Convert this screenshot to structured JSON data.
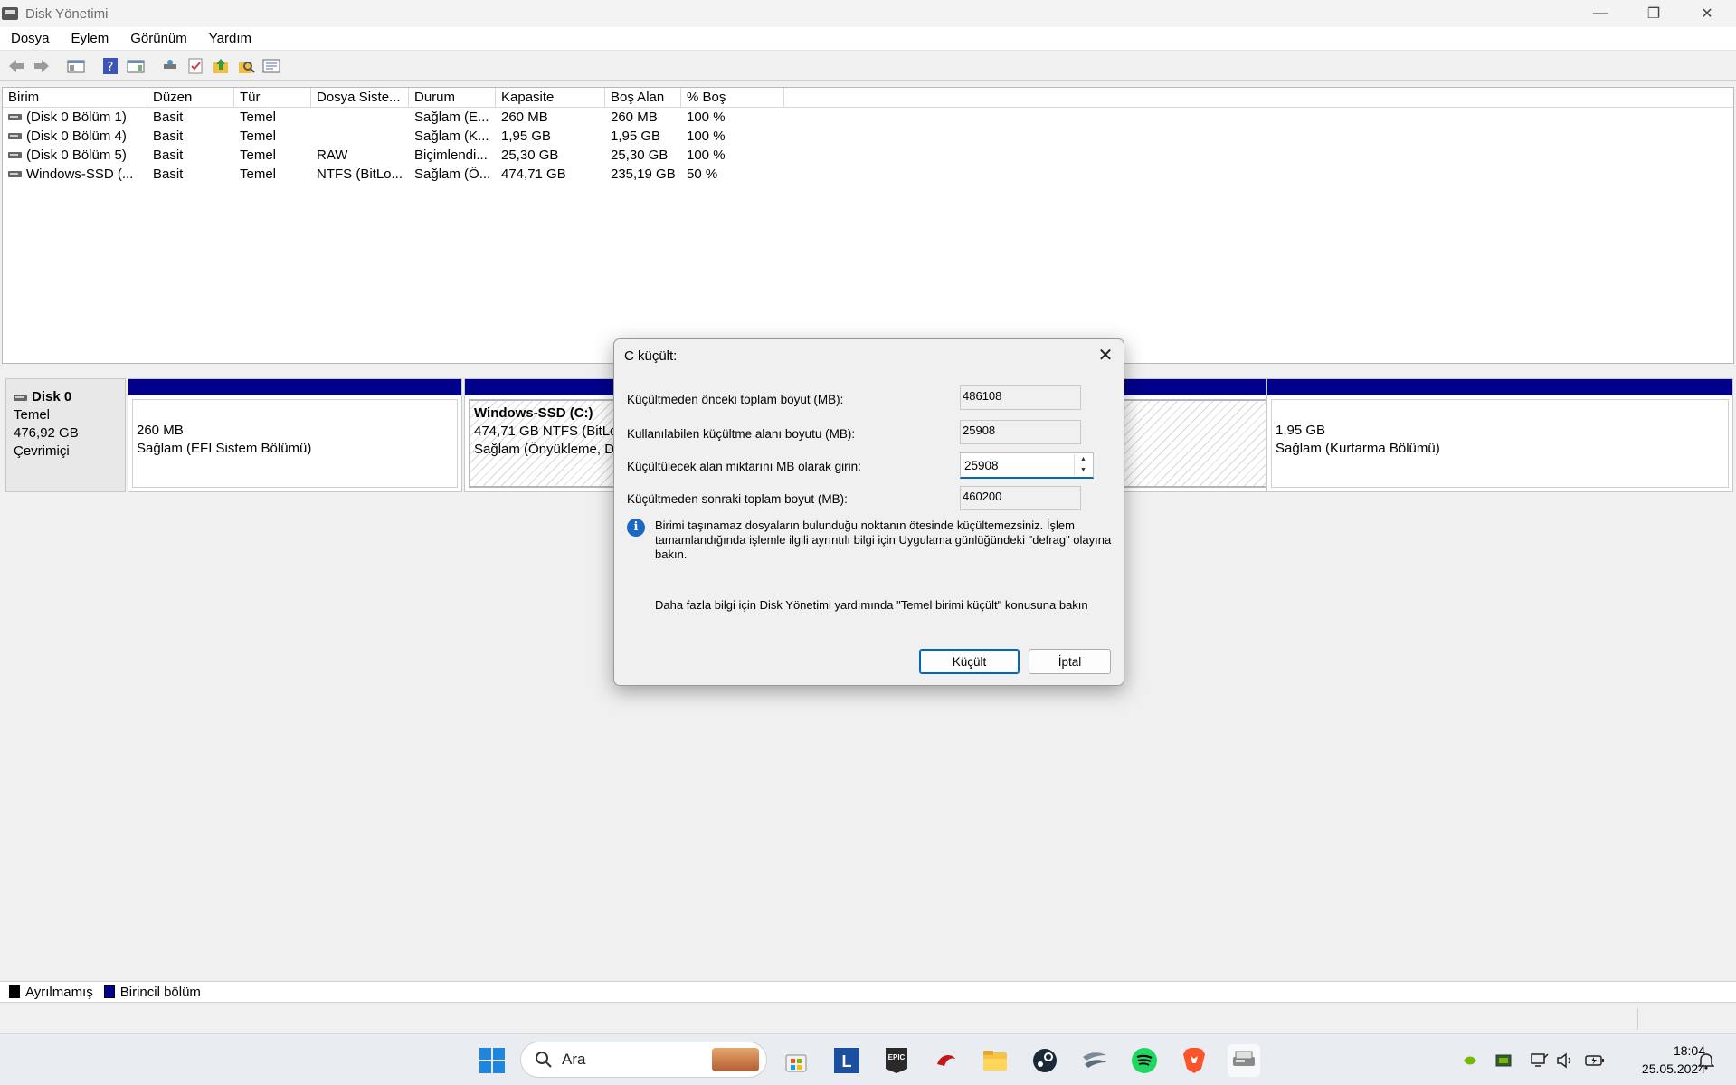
{
  "window": {
    "title": "Disk Yönetimi",
    "min_glyph": "—",
    "max_glyph": "❐",
    "close_glyph": "✕"
  },
  "menu": [
    "Dosya",
    "Eylem",
    "Görünüm",
    "Yardım"
  ],
  "volume_list": {
    "columns": [
      "Birim",
      "Düzen",
      "Tür",
      "Dosya Siste...",
      "Durum",
      "Kapasite",
      "Boş Alan",
      "% Boş"
    ],
    "rows": [
      [
        "(Disk 0 Bölüm 1)",
        "Basit",
        "Temel",
        "",
        "Sağlam (E...",
        "260 MB",
        "260 MB",
        "100 %"
      ],
      [
        "(Disk 0 Bölüm 4)",
        "Basit",
        "Temel",
        "",
        "Sağlam (K...",
        "1,95 GB",
        "1,95 GB",
        "100 %"
      ],
      [
        "(Disk 0 Bölüm 5)",
        "Basit",
        "Temel",
        "RAW",
        "Biçimlendi...",
        "25,30 GB",
        "25,30 GB",
        "100 %"
      ],
      [
        "Windows-SSD (...",
        "Basit",
        "Temel",
        "NTFS (BitLo...",
        "Sağlam (Ö...",
        "474,71 GB",
        "235,19 GB",
        "50 %"
      ]
    ]
  },
  "disk": {
    "name": "Disk 0",
    "type": "Temel",
    "size": "476,92 GB",
    "status": "Çevrimiçi",
    "partitions": [
      {
        "line1": "",
        "line2": "260 MB",
        "line3": "Sağlam (EFI Sistem Bölümü)"
      },
      {
        "line1": "Windows-SSD  (C:)",
        "line2": "474,71 GB NTFS (BitLoc",
        "line3": "Sağlam (Önyükleme, D"
      },
      {
        "line1": "",
        "line2": "1,95 GB",
        "line3": "Sağlam (Kurtarma Bölümü)"
      }
    ]
  },
  "legend": {
    "unallocated": "Ayrılmamış",
    "primary": "Birincil bölüm",
    "unallocated_color": "#000000",
    "primary_color": "#00008b"
  },
  "dialog": {
    "title": "C küçült:",
    "total_before_label": "Küçültmeden önceki toplam boyut (MB):",
    "total_before_value": "486108",
    "available_label": "Kullanılabilen küçültme alanı boyutu (MB):",
    "available_value": "25908",
    "enter_label": "Küçültülecek alan miktarını MB olarak girin:",
    "enter_value": "25908",
    "total_after_label": "Küçültmeden sonraki toplam boyut (MB):",
    "total_after_value": "460200",
    "info_text": "Birimi taşınamaz dosyaların bulunduğu noktanın ötesinde küçültemezsiniz. İşlem tamamlandığında işlemle ilgili ayrıntılı bilgi için Uygulama günlüğündeki \"defrag\" olayına bakın.",
    "help_text": "Daha fazla bilgi için Disk Yönetimi yardımında \"Temel birimi küçült\" konusuna bakın",
    "shrink_button": "Küçült",
    "cancel_button": "İptal"
  },
  "taskbar": {
    "search_label": "Ara",
    "time": "18:04",
    "date": "25.05.2024"
  }
}
